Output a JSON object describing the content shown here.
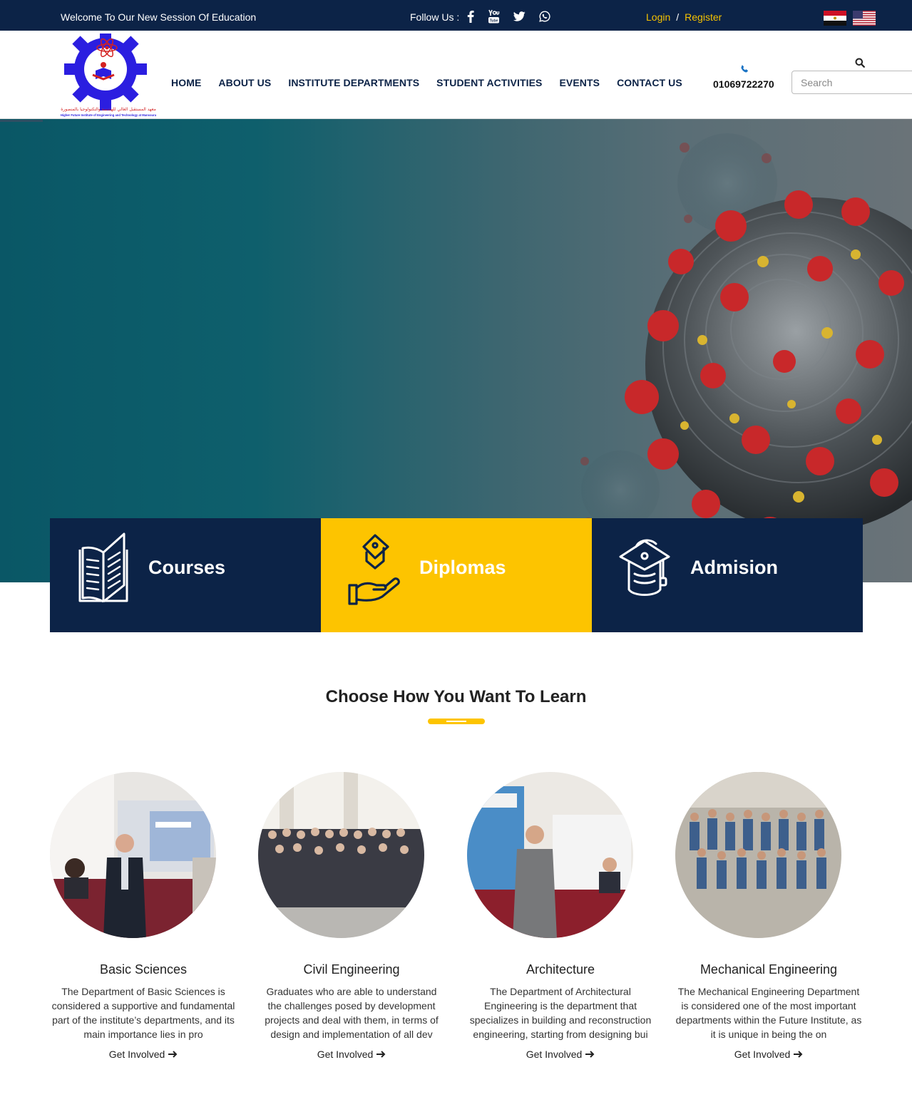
{
  "topbar": {
    "welcome": "Welcome To Our New Session Of Education",
    "follow_label": "Follow Us :",
    "social_icons": [
      "facebook-icon",
      "youtube-icon",
      "twitter-icon",
      "whatsapp-icon"
    ],
    "login": "Login",
    "separator": "/",
    "register": "Register",
    "languages": [
      "egypt-flag",
      "usa-flag"
    ]
  },
  "header": {
    "nav": [
      "HOME",
      "ABOUT US",
      "INSTITUTE DEPARTMENTS",
      "STUDENT ACTIVITIES",
      "EVENTS",
      "CONTACT US"
    ],
    "phone": "01069722270",
    "search_placeholder": "Search"
  },
  "features": [
    {
      "label": "Courses",
      "icon": "book-icon",
      "color": "#0c2347"
    },
    {
      "label": "Diplomas",
      "icon": "diploma-icon",
      "color": "#fdc400"
    },
    {
      "label": "Admision",
      "icon": "graduation-cap-icon",
      "color": "#0c2347"
    }
  ],
  "section": {
    "title": "Choose How You Want To Learn"
  },
  "departments": [
    {
      "name": "Basic Sciences",
      "description": "The Department of Basic Sciences is considered a supportive and fundamental part of the institute’s departments, and its main importance lies in pro",
      "link": "Get Involved"
    },
    {
      "name": "Civil Engineering",
      "description": "Graduates who are able to understand the challenges posed by development projects and deal with them, in terms of design and implementation of all dev",
      "link": "Get Involved"
    },
    {
      "name": "Architecture",
      "description": "The Department of Architectural Engineering is the department that specializes in building and reconstruction engineering, starting from designing bui",
      "link": "Get Involved"
    },
    {
      "name": "Mechanical Engineering",
      "description": "The Mechanical Engineering Department is considered one of the most important departments within the Future Institute, as it is unique in being the on",
      "link": "Get Involved"
    }
  ],
  "colors": {
    "navy": "#0c2347",
    "accent_yellow": "#fdc400",
    "hero_teal": "#0a5766"
  }
}
